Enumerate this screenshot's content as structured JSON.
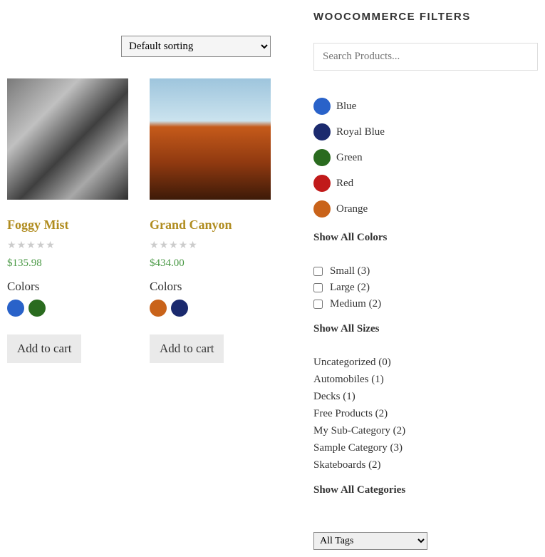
{
  "sorting": {
    "selected": "Default sorting"
  },
  "products": [
    {
      "title": "Foggy Mist",
      "price": "$135.98",
      "colors_label": "Colors",
      "swatches": [
        "#2962c9",
        "#2a6b1f"
      ],
      "cart_label": "Add to cart"
    },
    {
      "title": "Grand Canyon",
      "price": "$434.00",
      "colors_label": "Colors",
      "swatches": [
        "#c9631a",
        "#1b2a6e"
      ],
      "cart_label": "Add to cart"
    }
  ],
  "sidebar": {
    "heading": "WOOCOMMERCE FILTERS",
    "search_placeholder": "Search Products...",
    "colors": [
      {
        "label": "Blue",
        "hex": "#2962c9"
      },
      {
        "label": "Royal Blue",
        "hex": "#1b2a6e"
      },
      {
        "label": "Green",
        "hex": "#2a6b1f"
      },
      {
        "label": "Red",
        "hex": "#c11a1a"
      },
      {
        "label": "Orange",
        "hex": "#c9631a"
      }
    ],
    "show_all_colors": "Show All Colors",
    "sizes": [
      {
        "label": "Small (3)"
      },
      {
        "label": "Large (2)"
      },
      {
        "label": "Medium (2)"
      }
    ],
    "show_all_sizes": "Show All Sizes",
    "categories": [
      "Uncategorized (0)",
      "Automobiles (1)",
      "Decks (1)",
      "Free Products (2)",
      "My Sub-Category (2)",
      "Sample Category (3)",
      "Skateboards (2)"
    ],
    "show_all_categories": "Show All Categories",
    "tags_selected": "All Tags"
  }
}
